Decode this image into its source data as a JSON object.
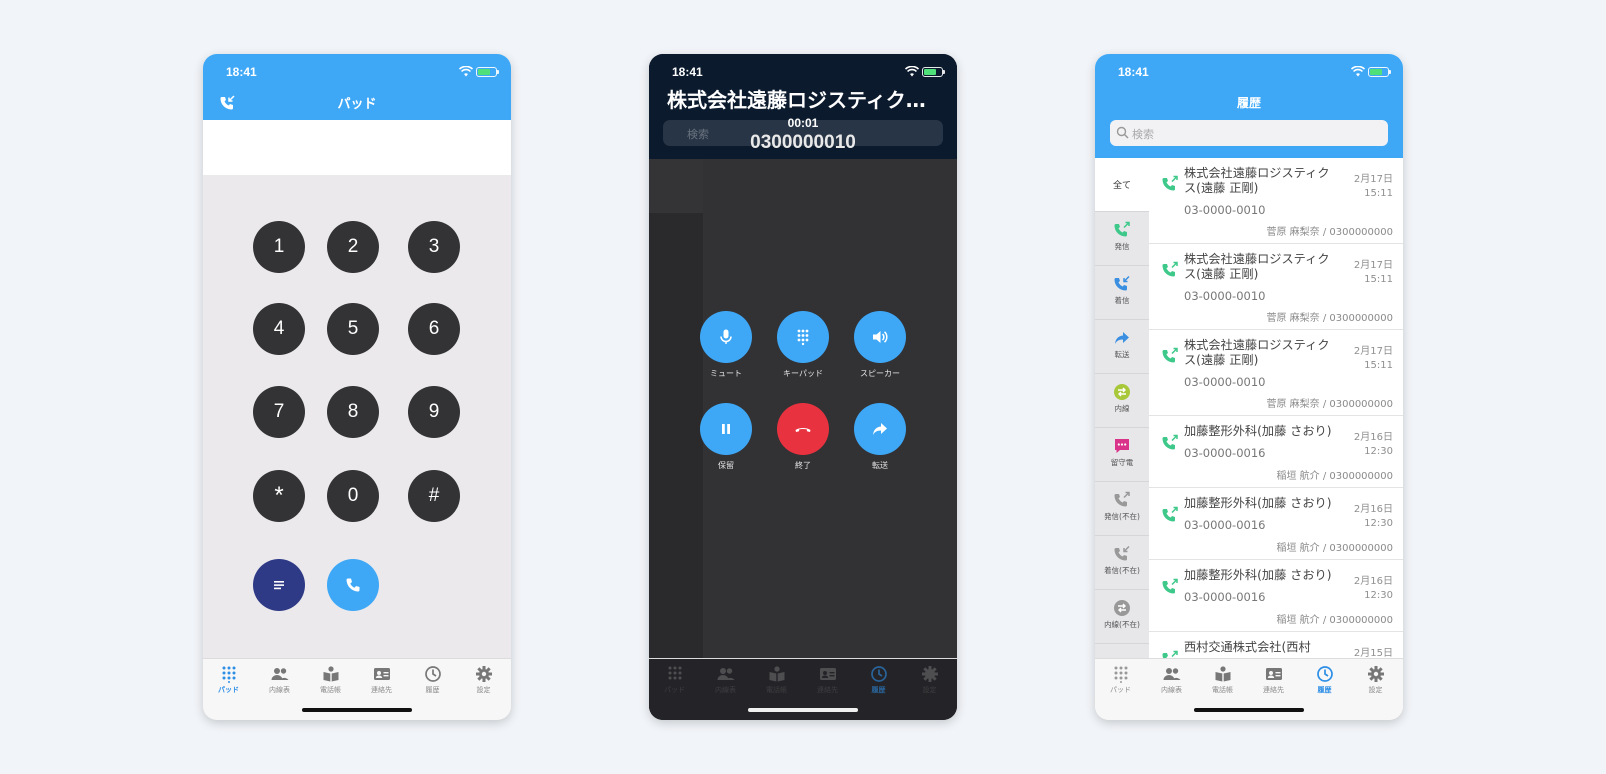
{
  "status": {
    "time": "18:41"
  },
  "pad": {
    "title": "パッド",
    "keys": [
      "1",
      "2",
      "3",
      "4",
      "5",
      "6",
      "7",
      "8",
      "9",
      "*",
      "0",
      "#"
    ]
  },
  "call": {
    "company": "株式会社遠藤ロジスティク…",
    "search_placeholder": "検索",
    "timer": "00:01",
    "number": "0300000010",
    "controls": [
      "ミュート",
      "キーパッド",
      "スピーカー",
      "保留",
      "終了",
      "転送"
    ]
  },
  "history": {
    "title": "履歴",
    "search_placeholder": "検索",
    "filters": [
      "全て",
      "発信",
      "着信",
      "転送",
      "内線",
      "留守電",
      "発信(不在)",
      "着信(不在)",
      "内線(不在)"
    ],
    "rows": [
      {
        "name": "株式会社遠藤ロジスティクス(遠藤 正剛)",
        "date": "2月17日",
        "time": "15:11",
        "number": "03-0000-0010",
        "who": "菅原 麻梨奈 / 0300000000"
      },
      {
        "name": "株式会社遠藤ロジスティクス(遠藤 正剛)",
        "date": "2月17日",
        "time": "15:11",
        "number": "03-0000-0010",
        "who": "菅原 麻梨奈 / 0300000000"
      },
      {
        "name": "株式会社遠藤ロジスティクス(遠藤 正剛)",
        "date": "2月17日",
        "time": "15:11",
        "number": "03-0000-0010",
        "who": "菅原 麻梨奈 / 0300000000"
      },
      {
        "name": "加藤整形外科(加藤 さおり)",
        "date": "2月16日",
        "time": "12:30",
        "number": "03-0000-0016",
        "who": "稲垣 航介 / 0300000000"
      },
      {
        "name": "加藤整形外科(加藤 さおり)",
        "date": "2月16日",
        "time": "12:30",
        "number": "03-0000-0016",
        "who": "稲垣 航介 / 0300000000"
      },
      {
        "name": "加藤整形外科(加藤 さおり)",
        "date": "2月16日",
        "time": "12:30",
        "number": "03-0000-0016",
        "who": "稲垣 航介 / 0300000000"
      },
      {
        "name": "西村交通株式会社(西村",
        "date": "2月15日",
        "time": "",
        "number": "",
        "who": ""
      }
    ]
  },
  "tabs": [
    "パッド",
    "内線表",
    "電話帳",
    "連絡先",
    "履歴",
    "設定"
  ],
  "colors": {
    "accent": "#3ea8f7",
    "end": "#e8323f",
    "memo": "#2f3a86",
    "key": "#333335",
    "outgoing": "#3ec98a"
  }
}
